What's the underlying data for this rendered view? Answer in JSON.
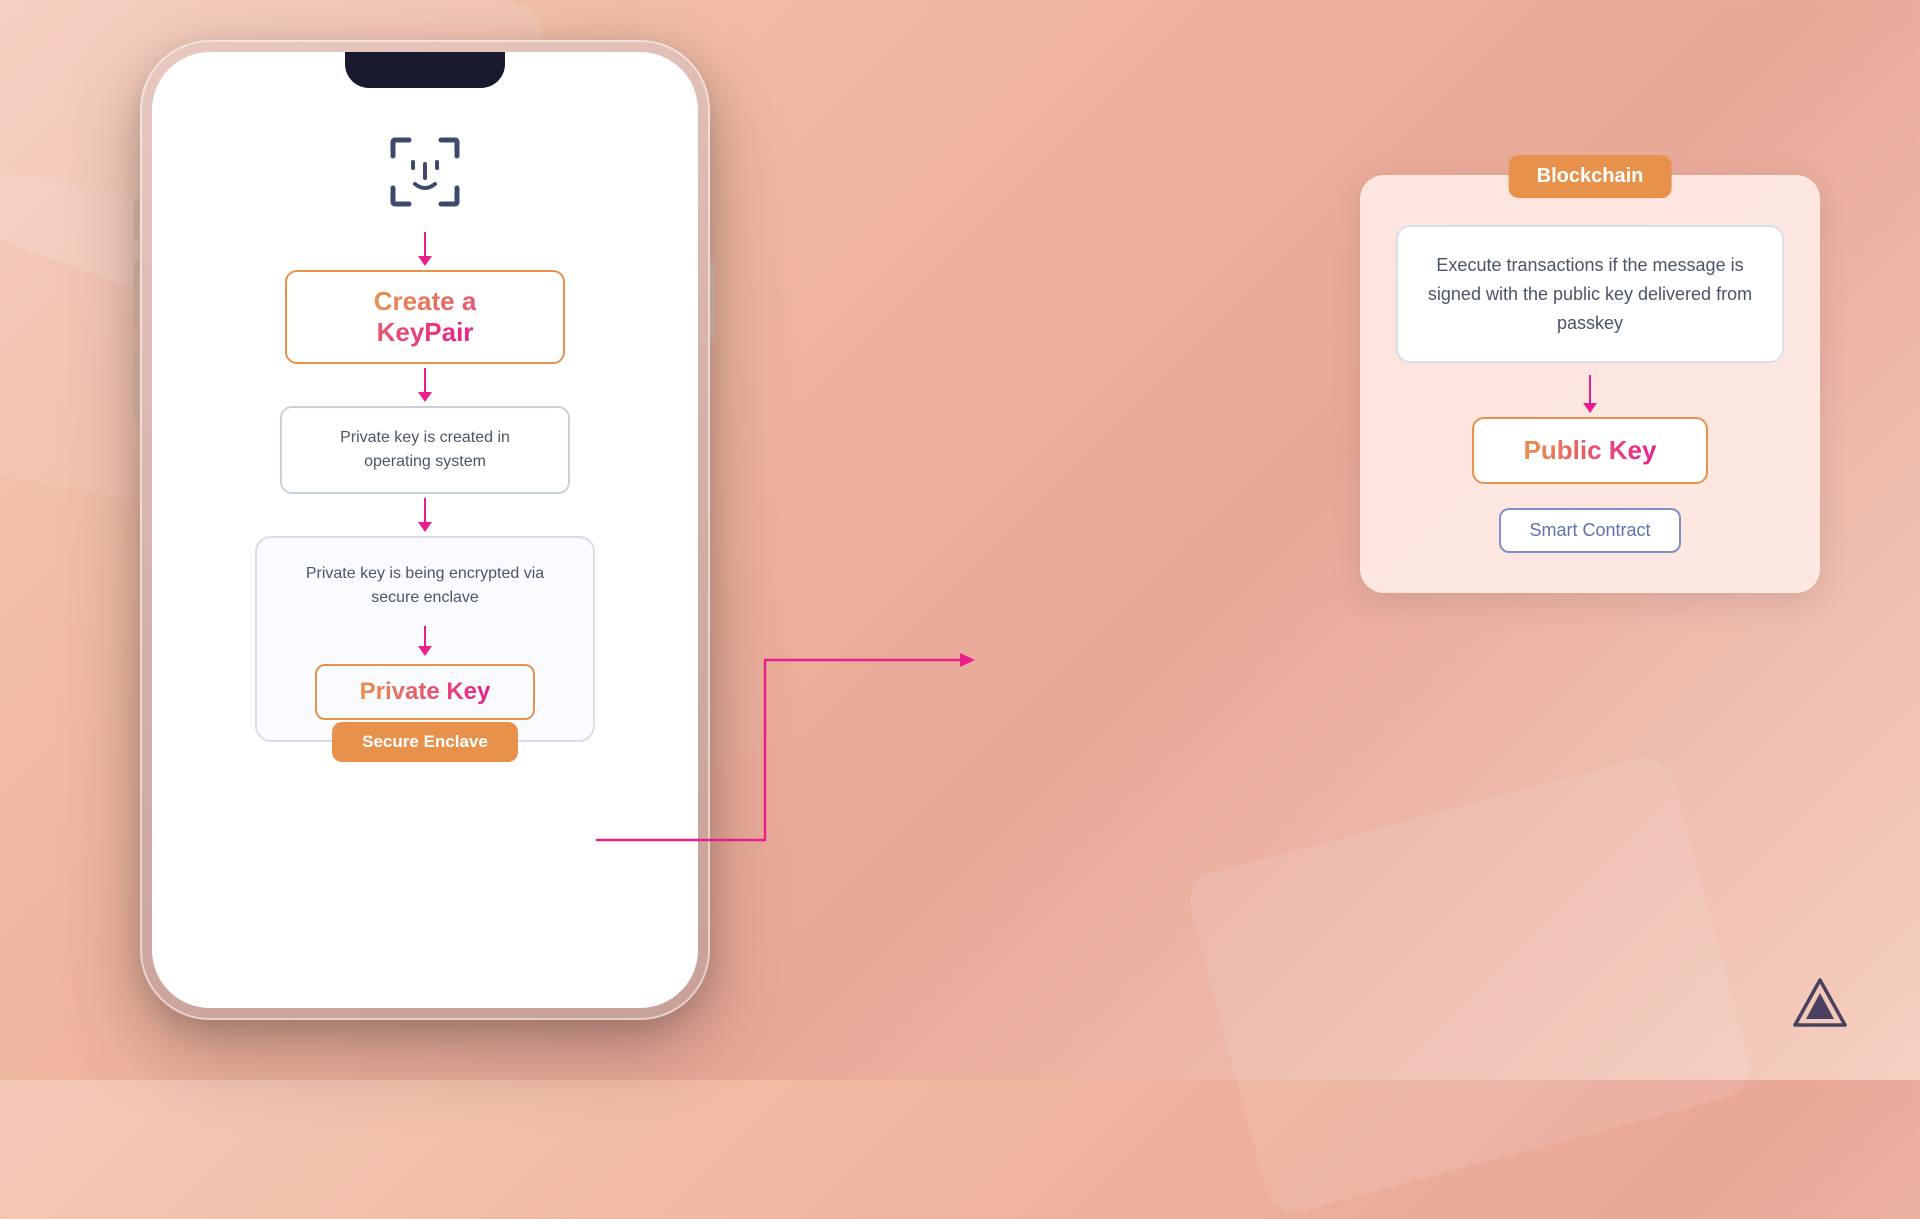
{
  "background": {
    "color": "#f0b8a0"
  },
  "phone": {
    "faceid_icon": "face-id",
    "flow": {
      "create_keypair": {
        "label": "Create a KeyPair"
      },
      "private_key_created": {
        "label": "Private key is created in operating system"
      },
      "private_key_encrypted": {
        "label": "Private key is being encrypted via secure enclave"
      },
      "private_key": {
        "label": "Private Key"
      },
      "secure_enclave": {
        "label": "Secure Enclave"
      }
    }
  },
  "blockchain": {
    "label": "Blockchain",
    "description": "Execute transactions if the message is signed with the public key delivered from passkey",
    "public_key": {
      "label": "Public Key"
    },
    "smart_contract": {
      "label": "Smart Contract"
    }
  },
  "logo": {
    "name": "alchemy-logo"
  }
}
